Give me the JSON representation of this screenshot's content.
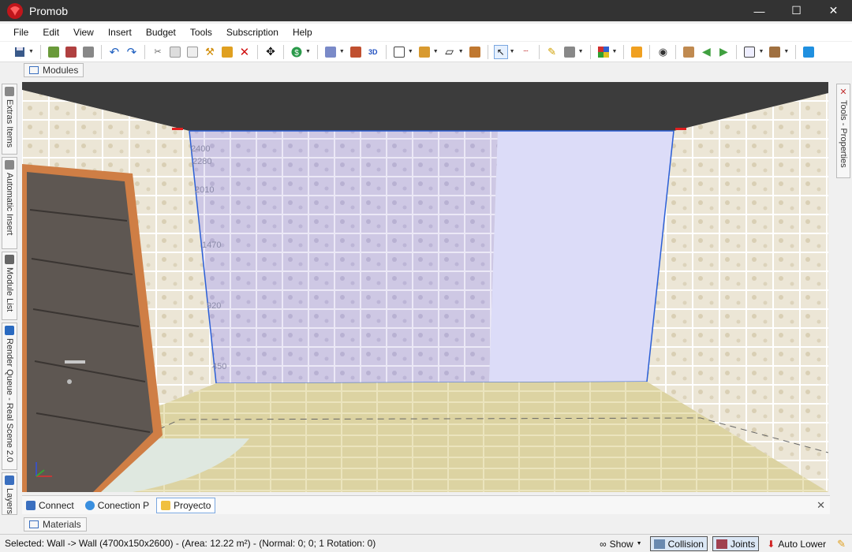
{
  "app": {
    "title": "Promob"
  },
  "window_controls": {
    "minimize": "—",
    "maximize": "☐",
    "close": "✕"
  },
  "menu": [
    "File",
    "Edit",
    "View",
    "Insert",
    "Budget",
    "Tools",
    "Subscription",
    "Help"
  ],
  "panels": {
    "modules": "Modules",
    "materials": "Materials",
    "left_tabs": [
      "Extras Items",
      "Automatic Insert",
      "Module List",
      "Render Queue - Real Scene 2.0",
      "Layers"
    ],
    "right_tab": "Tools - Properties"
  },
  "viewport": {
    "dimension_labels": [
      "2400",
      "2280",
      "2010",
      "1470",
      "920",
      "450"
    ]
  },
  "bottom_tabs": [
    {
      "label": "Connect",
      "active": false
    },
    {
      "label": "Conection P",
      "active": false
    },
    {
      "label": "Proyecto",
      "active": true
    }
  ],
  "status": {
    "text": "Selected: Wall -> Wall (4700x150x2600) - (Area: 12.22 m²) - (Normal: 0; 0; 1 Rotation: 0)",
    "show": "Show",
    "collision": "Collision",
    "joints": "Joints",
    "auto_lower": "Auto Lower"
  },
  "colors": {
    "titlebar": "#333333",
    "accent_blue": "#2b5fd6",
    "wall_tile": "#c8c0e0",
    "floor": "#d8cf9c"
  }
}
